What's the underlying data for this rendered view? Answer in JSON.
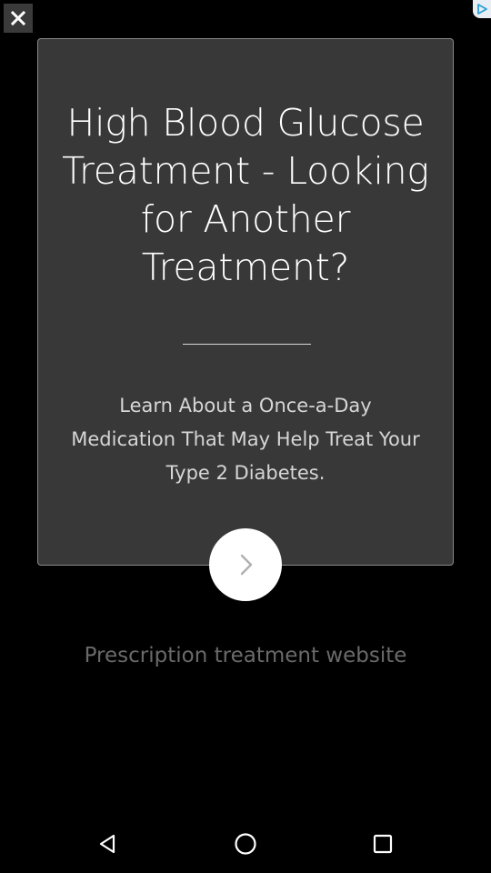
{
  "ad": {
    "headline": "High Blood Glucose Treatment - Looking for Another Treatment?",
    "description": "Learn About a Once-a-Day Medication That May Help Treat Your Type 2 Diabetes.",
    "footer": "Prescription treatment website"
  },
  "icons": {
    "close": "close-icon",
    "adchoices": "adchoices-icon",
    "next": "chevron-right-icon",
    "back": "back-icon",
    "home": "home-icon",
    "recents": "recents-icon"
  },
  "colors": {
    "background": "#000000",
    "card": "#383838",
    "card_border": "#8a8a8a",
    "headline": "#ffffff",
    "description": "#d6d6d6",
    "footer": "#6a6a6a",
    "next_button": "#ffffff"
  }
}
